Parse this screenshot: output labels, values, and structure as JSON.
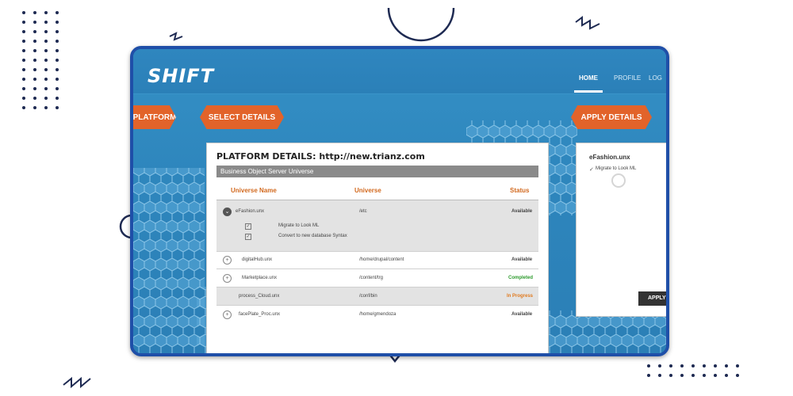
{
  "app": {
    "logo": "SHIFT"
  },
  "nav": {
    "home": "HOME",
    "profile": "PROFILE",
    "log": "LOG"
  },
  "steps": {
    "platform": "PLATFORM",
    "select": "SELECT DETAILS",
    "apply": "APPLY DETAILS"
  },
  "platform_panel": {
    "title": "PLATFORM DETAILS:  http://new.trianz.com",
    "section": "Business Object Server Universe",
    "headers": {
      "name": "Universe Name",
      "universe": "Universe",
      "status": "Status"
    },
    "rows": [
      {
        "name": "eFashion.unx",
        "path": "/etc",
        "status": "Available",
        "expanded": true,
        "options": [
          "Migrate to Look ML",
          "Convert to new database Syntax"
        ]
      },
      {
        "name": "digitalHub.unx",
        "path": "/home/drupal/content",
        "status": "Available"
      },
      {
        "name": "Marketplace.unx",
        "path": "/content/trg",
        "status": "Completed"
      },
      {
        "name": "process_Cloud.unx",
        "path": "/conf/bin",
        "status": "In Progress"
      },
      {
        "name": "facePlate_Proc.unx",
        "path": "/home/gmendoza",
        "status": "Available"
      }
    ]
  },
  "apply_panel": {
    "title": "eFashion.unx",
    "item": "Migrate to Look ML",
    "button": "APPLY"
  },
  "colors": {
    "accent": "#e2632a",
    "frame": "#1f4fa8",
    "completed": "#2e9b2e",
    "inprogress": "#e07a1f"
  }
}
